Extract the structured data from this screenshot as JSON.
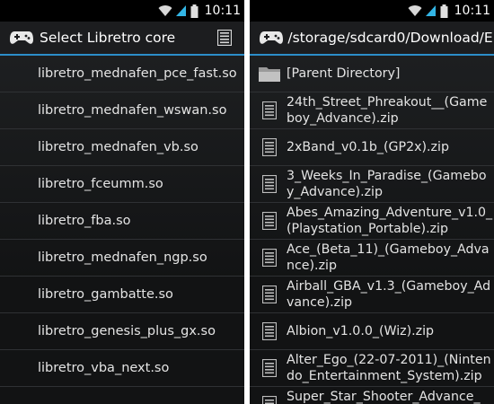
{
  "status_bar": {
    "time": "10:11",
    "icons": [
      "wifi-icon",
      "signal-icon",
      "battery-icon"
    ]
  },
  "left_panel": {
    "title": "Select Libretro core",
    "items": [
      "libretro_mednafen_pce_fast.so",
      "libretro_mednafen_wswan.so",
      "libretro_mednafen_vb.so",
      "libretro_fceumm.so",
      "libretro_fba.so",
      "libretro_mednafen_ngp.so",
      "libretro_gambatte.so",
      "libretro_genesis_plus_gx.so",
      "libretro_vba_next.so"
    ]
  },
  "right_panel": {
    "title": "/storage/sdcard0/Download/E...",
    "parent_dir_label": "[Parent Directory]",
    "files": [
      "24th_Street_Phreakout__(Gameboy_Advance).zip",
      "2xBand_v0.1b_(GP2x).zip",
      "3_Weeks_In_Paradise_(Gameboy_Advance).zip",
      "Abes_Amazing_Adventure_v1.0_(Playstation_Portable).zip",
      "Ace_(Beta_11)_(Gameboy_Advance).zip",
      "Airball_GBA_v1.3_(Gameboy_Advance).zip",
      "Albion_v1.0.0_(Wiz).zip",
      "Alter_Ego_(22-07-2011)_(Nintendo_Entertainment_System).zip",
      "Super_Star_Shooter_Advance_(G"
    ]
  },
  "colors": {
    "accent": "#2c8ec9",
    "background": "#141516",
    "text": "#e4e4e4",
    "divider": "#2f3134"
  },
  "icons": {
    "app": "gamepad-icon",
    "menu": "list-menu-icon",
    "folder": "folder-icon",
    "file": "file-icon"
  }
}
